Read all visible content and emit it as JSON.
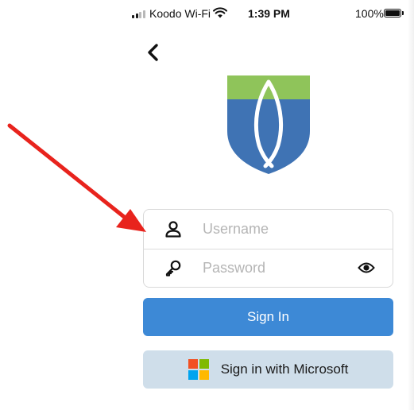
{
  "status_bar": {
    "carrier": "Koodo Wi-Fi",
    "time": "1:39 PM",
    "battery": "100%"
  },
  "login": {
    "username_placeholder": "Username",
    "password_placeholder": "Password",
    "sign_in_label": "Sign In",
    "microsoft_label": "Sign in with Microsoft"
  },
  "colors": {
    "primary_button": "#3d89d6",
    "microsoft_button": "#cfdeea",
    "logo_green": "#8fc45a",
    "logo_blue": "#3f73b4",
    "annotation_arrow": "#e8231d"
  },
  "icons": [
    "back-chevron-icon",
    "wifi-icon",
    "battery-icon",
    "person-icon",
    "key-icon",
    "eye-icon",
    "microsoft-logo-icon",
    "shield-fish-logo"
  ]
}
